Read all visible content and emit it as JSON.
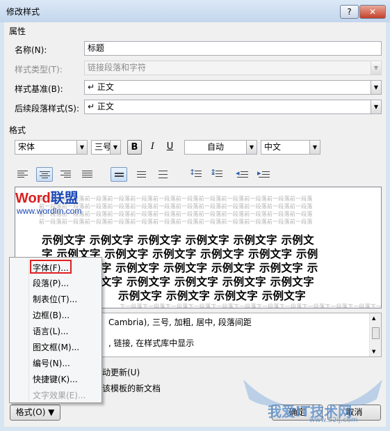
{
  "window": {
    "title": "修改样式",
    "help_label": "?",
    "close_label": "✕"
  },
  "properties": {
    "section_label": "属性",
    "name": {
      "label": "名称(N):",
      "value": "标题"
    },
    "style_type": {
      "label": "样式类型(T):",
      "value": "链接段落和字符"
    },
    "style_based_on": {
      "label": "样式基准(B):",
      "value": "↵ 正文"
    },
    "next_style": {
      "label": "后续段落样式(S):",
      "value": "↵ 正文"
    }
  },
  "format": {
    "section_label": "格式",
    "font": "宋体",
    "size": "三号",
    "bold": "B",
    "italic": "I",
    "underline": "U",
    "color": "自动",
    "script": "中文"
  },
  "preview": {
    "ghost_lines": [
      "前一段落前一段落前一段落前一段落前一段落前一段落前一段落前一段落前一段落前一段落前一段落前一段落",
      "前一段落前一段落前一段落前一段落前一段落前一段落前一段落前一段落前一段落前一段落前一段落前一段落",
      "前一段落前一段落前一段落前一段落前一段落前一段落前一段落前一段落前一段落前一段落前一段落前一段落",
      "前一段落前一段落前一段落前一段落前一段落前一段落前一段落前一段落前一段落前一段落前一段落前一段落"
    ],
    "sample_lines": [
      "示例文字 示例文字 示例文字 示例文字 示例文字 示例文",
      "字 示例文字 示例文字 示例文字 示例文字 示例文字 示例",
      "文字 示例文字 示例文字 示例文字 示例文字 示例文字 示",
      "例文字 示例文字 示例文字 示例文字 示例文字 示例文字",
      "示例文字 示例文字 示例文字 示例文字"
    ],
    "after_line": "下一段落下一段落下一段落下一段落下一段落下一段落下一段落下一段落下一段落下一段落下一段落下一段落",
    "logo_word": "Word",
    "logo_brand": "联盟",
    "logo_url": "www.wordlm.com"
  },
  "description": {
    "line1": "Cambria), 三号, 加粗, 居中, 段落间距",
    "line2": ", 链接, 在样式库中显示"
  },
  "options": {
    "auto_update": "动更新(U)",
    "new_docs": "该模板的新文档"
  },
  "context_menu": {
    "items": [
      "字体(F)...",
      "段落(P)...",
      "制表位(T)...",
      "边框(B)...",
      "语言(L)...",
      "图文框(M)...",
      "编号(N)...",
      "快捷键(K)...",
      "文字效果(E)..."
    ]
  },
  "buttons": {
    "format": "格式(O) ▼",
    "ok": "确定",
    "cancel": "取消"
  },
  "watermark": {
    "text": "我爱IT技术网",
    "url": "www.52ij.com"
  },
  "colors": {
    "highlight_box": "#e02020",
    "logo_red": "#d91f1f",
    "logo_blue": "#1a48b8"
  }
}
